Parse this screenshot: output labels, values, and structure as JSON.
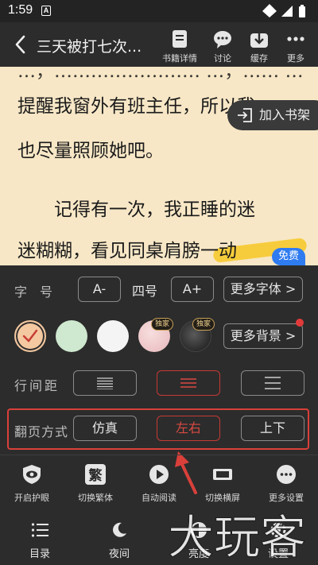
{
  "status_bar": {
    "time": "1:59",
    "notification_letter": "A"
  },
  "header": {
    "book_title": "三天被打七次...",
    "tools": [
      {
        "icon": "book-details-icon",
        "label": "书籍详情"
      },
      {
        "icon": "discussion-icon",
        "label": "讨论"
      },
      {
        "icon": "download-icon",
        "label": "缓存"
      },
      {
        "icon": "more-icon",
        "label": "更多"
      }
    ]
  },
  "reader": {
    "partial_top_line": "…，…………………… …，…… …",
    "lines": [
      "提醒我窗外有班主任，所以我",
      "也尽量照顾她吧。",
      "　　记得有一次，我正睡的迷",
      "迷糊糊，看见同桌肩膀一动"
    ],
    "add_to_shelf": "加入书架",
    "free_badge": "免费"
  },
  "settings": {
    "font_row": {
      "label": "字　号",
      "decrease": "A-",
      "current_size": "四号",
      "increase": "A+",
      "more_fonts": "更多字体 >"
    },
    "background_row": {
      "swatches": [
        {
          "name": "warm",
          "color": "#f4c8a0",
          "selected": true
        },
        {
          "name": "green",
          "color": "#cfe8d0"
        },
        {
          "name": "white",
          "color": "#f4f4f4"
        },
        {
          "name": "pink-pattern",
          "color": "#ebc2c5",
          "exclusive": true
        },
        {
          "name": "dark-pattern",
          "color": "#2a2a2a",
          "exclusive": true
        }
      ],
      "exclusive_badge": "独家",
      "more_backgrounds": "更多背景 >",
      "more_backgrounds_has_dot": true
    },
    "line_spacing_row": {
      "label": "行间距",
      "options": [
        "compact",
        "standard",
        "loose"
      ],
      "selected": "standard"
    },
    "page_turn_row": {
      "label": "翻页方式",
      "options": [
        "仿真",
        "左右",
        "上下"
      ],
      "selected": "左右"
    },
    "features": [
      {
        "icon": "eye-protection-icon",
        "label": "开启护眼"
      },
      {
        "icon": "traditional-chinese-icon",
        "glyph": "繁",
        "label": "切换繁体"
      },
      {
        "icon": "auto-read-icon",
        "label": "自动阅读"
      },
      {
        "icon": "landscape-icon",
        "label": "切换横屏"
      },
      {
        "icon": "more-settings-icon",
        "label": "更多设置"
      }
    ],
    "bottom_nav": [
      {
        "icon": "table-of-contents-icon",
        "label": "目录"
      },
      {
        "icon": "night-mode-icon",
        "label": "夜间"
      },
      {
        "icon": "brightness-icon",
        "label": "亮度"
      },
      {
        "icon": "settings-icon",
        "label": "设置"
      }
    ]
  },
  "colors": {
    "panel_bg": "#2c2c2c",
    "page_bg": "#f7e7c6",
    "accent_red": "#d9403a",
    "badge_blue": "#2f7bf0"
  },
  "watermark": "大玩客"
}
